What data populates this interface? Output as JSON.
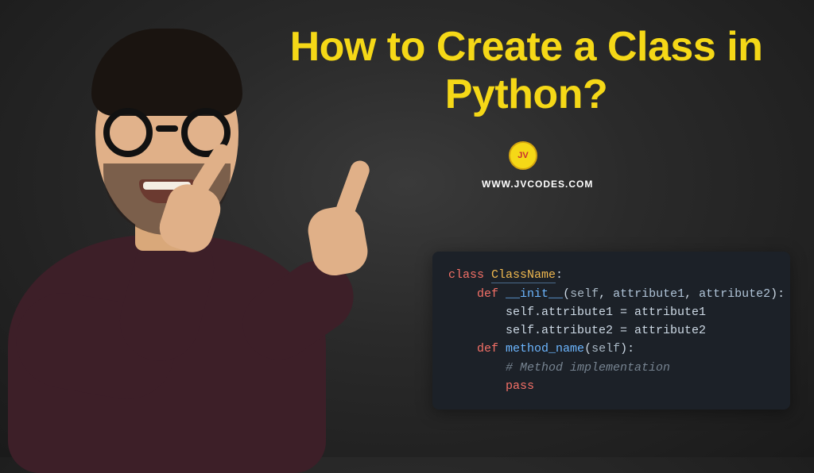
{
  "title": "How to Create a Class in Python?",
  "logo_text": "JV",
  "site": "WWW.JVCODES.COM",
  "code": {
    "l1_kw": "class",
    "l1_cls": "ClassName",
    "l1_colon": ":",
    "l2_indent": "    ",
    "l2_kw": "def",
    "l2_fn": "__init__",
    "l2_open": "(",
    "l2_self": "self",
    "l2_c1": ", ",
    "l2_p1": "attribute1",
    "l2_c2": ", ",
    "l2_p2": "attribute2",
    "l2_close": "):",
    "l3": "        self.attribute1 = attribute1",
    "l4": "        self.attribute2 = attribute2",
    "l5": "",
    "l6_indent": "    ",
    "l6_kw": "def",
    "l6_fn": "method_name",
    "l6_open": "(",
    "l6_self": "self",
    "l6_close": "):",
    "l7_indent": "        ",
    "l7_comment": "# Method implementation",
    "l8_indent": "        ",
    "l8_kw": "pass"
  }
}
